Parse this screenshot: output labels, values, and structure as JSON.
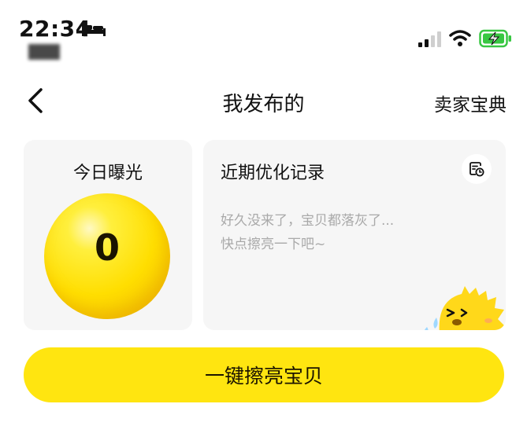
{
  "status_bar": {
    "time": "22:34",
    "icons": [
      "bed-icon",
      "signal-icon",
      "wifi-icon",
      "battery-charging-icon"
    ],
    "battery_color": "#38c742"
  },
  "nav": {
    "back_icon": "chevron-left-icon",
    "title": "我发布的",
    "right_link": "卖家宝典"
  },
  "exposure": {
    "title": "今日曝光",
    "value": "0",
    "ball_color": "#ffde00"
  },
  "records": {
    "title": "近期优化记录",
    "icon": "history-icon",
    "hint_line1": "好久没来了，宝贝都落灰了...",
    "hint_line2": "快点擦亮一下吧~",
    "mascot": "crying-mascot-icon"
  },
  "cta": {
    "label": "一键擦亮宝贝",
    "color": "#ffe510"
  }
}
